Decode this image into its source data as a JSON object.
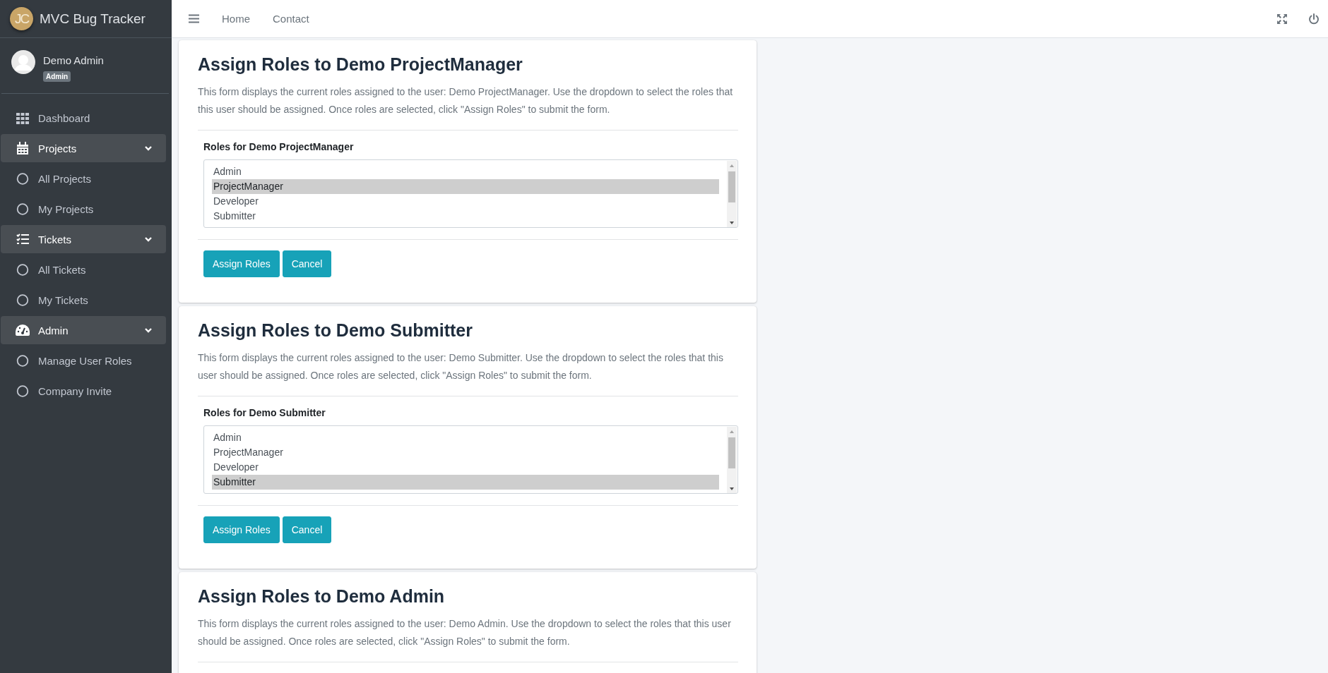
{
  "brand": {
    "logo": "JC",
    "title": "MVC Bug Tracker"
  },
  "topbar": {
    "links": [
      "Home",
      "Contact"
    ]
  },
  "user": {
    "name": "Demo Admin",
    "badge": "Admin"
  },
  "sidebar": {
    "items": [
      {
        "label": "Dashboard",
        "kind": "link"
      },
      {
        "label": "Projects",
        "kind": "group",
        "expanded": true,
        "children": [
          {
            "label": "All Projects"
          },
          {
            "label": "My Projects"
          }
        ]
      },
      {
        "label": "Tickets",
        "kind": "group",
        "expanded": true,
        "children": [
          {
            "label": "All Tickets"
          },
          {
            "label": "My Tickets"
          }
        ]
      },
      {
        "label": "Admin",
        "kind": "group",
        "expanded": true,
        "children": [
          {
            "label": "Manage User Roles"
          },
          {
            "label": "Company Invite"
          }
        ]
      }
    ]
  },
  "forms": [
    {
      "title": "Assign Roles to Demo ProjectManager",
      "description": "This form displays the current roles assigned to the user: Demo ProjectManager. Use the dropdown to select the roles that this user should be assigned. Once roles are selected, click \"Assign Roles\" to submit the form.",
      "label": "Roles for Demo ProjectManager",
      "options": [
        {
          "label": "Admin",
          "selected": false
        },
        {
          "label": "ProjectManager",
          "selected": true
        },
        {
          "label": "Developer",
          "selected": false
        },
        {
          "label": "Submitter",
          "selected": false
        }
      ],
      "buttons": [
        "Assign Roles",
        "Cancel"
      ]
    },
    {
      "title": "Assign Roles to Demo Submitter",
      "description": "This form displays the current roles assigned to the user: Demo Submitter. Use the dropdown to select the roles that this user should be assigned. Once roles are selected, click \"Assign Roles\" to submit the form.",
      "label": "Roles for Demo Submitter",
      "options": [
        {
          "label": "Admin",
          "selected": false
        },
        {
          "label": "ProjectManager",
          "selected": false
        },
        {
          "label": "Developer",
          "selected": false
        },
        {
          "label": "Submitter",
          "selected": true
        }
      ],
      "buttons": [
        "Assign Roles",
        "Cancel"
      ]
    },
    {
      "title": "Assign Roles to Demo Admin",
      "description": "This form displays the current roles assigned to the user: Demo Admin. Use the dropdown to select the roles that this user should be assigned. Once roles are selected, click \"Assign Roles\" to submit the form."
    }
  ]
}
